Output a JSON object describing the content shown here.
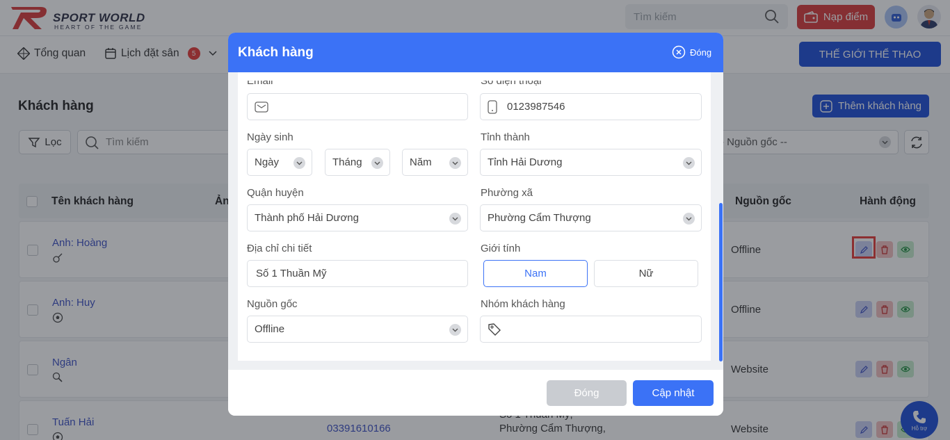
{
  "brand": {
    "name": "SPORT WORLD",
    "tagline": "HEART OF THE GAME"
  },
  "header": {
    "search_placeholder": "Tìm kiếm",
    "recharge_label": "Nạp điểm"
  },
  "nav": {
    "overview": "Tổng quan",
    "booking": "Lịch đặt sân",
    "booking_badge": "5",
    "brand_button": "THẾ GIỚI THỂ THAO"
  },
  "page": {
    "title": "Khách hàng",
    "add_button": "Thêm khách hàng",
    "filter_label": "Lọc",
    "search_placeholder": "Tìm kiếm",
    "source_filter": "-- Nguồn gốc --"
  },
  "table": {
    "columns": {
      "name": "Tên khách hàng",
      "image": "Ảnh",
      "source": "Nguồn gốc",
      "actions": "Hành động"
    },
    "rows": [
      {
        "name": "Anh: Hoàng",
        "source": "Offline"
      },
      {
        "name": "Anh: Huy",
        "source": "Offline"
      },
      {
        "name": "Ngân",
        "source": "Website"
      },
      {
        "name": "Tuấn Hải",
        "source": "Website",
        "phone": "03391610166",
        "address_line1": "Số 1 Thuần Mỹ,",
        "address_line2": "Phường Cẩm Thượng,"
      }
    ]
  },
  "support": {
    "label": "Hỗ trợ"
  },
  "modal": {
    "title": "Khách hàng",
    "close_top": "Đóng",
    "email_label": "Email",
    "email_value": "",
    "phone_label": "Số điện thoại",
    "phone_value": "0123987546",
    "birth_label": "Ngày sinh",
    "birth_day": "Ngày",
    "birth_month": "Tháng",
    "birth_year": "Năm",
    "province_label": "Tỉnh thành",
    "province_value": "Tỉnh Hải Dương",
    "district_label": "Quận huyện",
    "district_value": "Thành phố Hải Dương",
    "ward_label": "Phường xã",
    "ward_value": "Phường Cẩm Thượng",
    "address_label": "Địa chỉ chi tiết",
    "address_value": "Số 1 Thuần Mỹ",
    "gender_label": "Giới tính",
    "gender_male": "Nam",
    "gender_female": "Nữ",
    "source_label": "Nguồn gốc",
    "source_value": "Offline",
    "group_label": "Nhóm khách hàng",
    "group_value": "",
    "btn_close": "Đóng",
    "btn_update": "Cập nhật"
  },
  "colors": {
    "primary": "#3b72f6",
    "brand_blue": "#1d4ed8",
    "danger": "#d93a3a",
    "link": "#3b4fc4"
  }
}
